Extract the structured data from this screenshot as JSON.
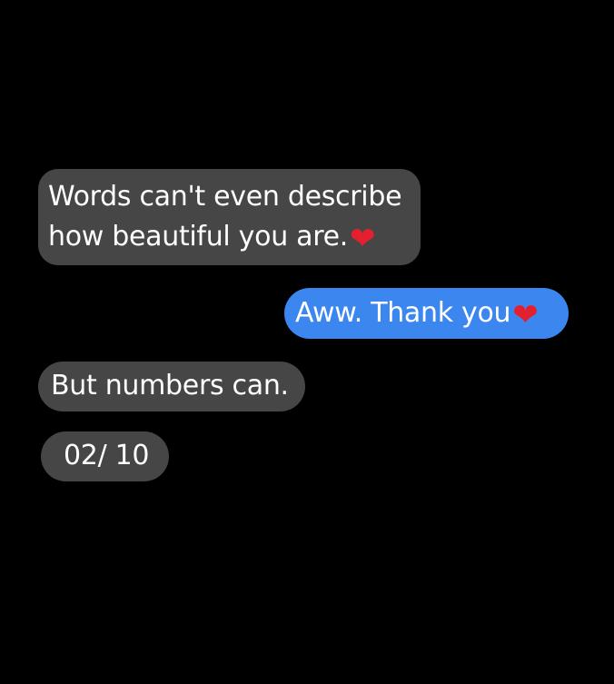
{
  "messages": [
    {
      "direction": "incoming",
      "line1": "Words can't even describe",
      "line2": "how beautiful you are."
    },
    {
      "direction": "outgoing",
      "text": "Aww. Thank you"
    },
    {
      "direction": "incoming",
      "text": "But numbers can."
    },
    {
      "direction": "incoming",
      "text": "02/ 10"
    }
  ],
  "icons": {
    "heart": "❤",
    "heart_name": "heart-icon"
  },
  "colors": {
    "background": "#000000",
    "incoming_bubble": "#464646",
    "outgoing_bubble": "#3c86f0",
    "text": "#ffffff",
    "heart": "#e4202e"
  }
}
